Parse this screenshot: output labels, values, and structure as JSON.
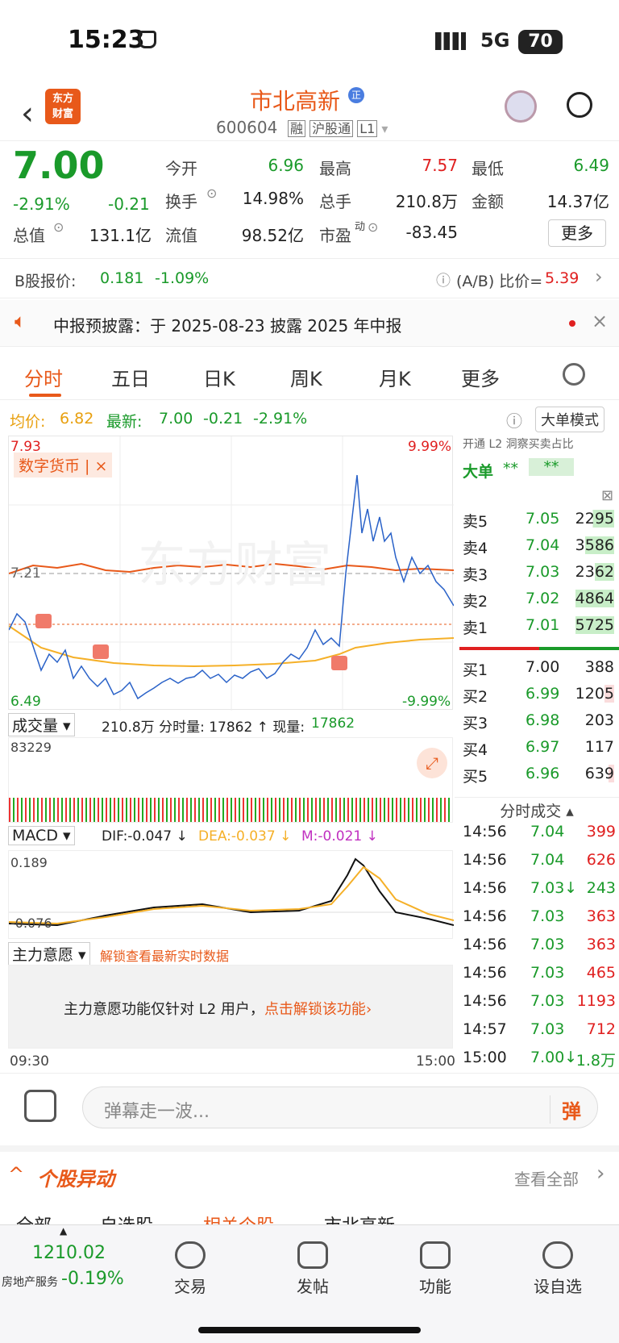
{
  "status": {
    "time": "15:23",
    "network": "5G",
    "battery": "70"
  },
  "header": {
    "stock_name": "市北高新",
    "badge": "正",
    "code": "600604",
    "tags": [
      "融",
      "沪股通",
      "L1"
    ]
  },
  "quote": {
    "price": "7.00",
    "pct": "-2.91%",
    "chg": "-0.21",
    "f1": [
      {
        "k": "今开",
        "v": "6.96"
      },
      {
        "k": "最高",
        "v": "7.57"
      },
      {
        "k": "最低",
        "v": "6.49"
      }
    ],
    "f2": [
      {
        "k": "换手",
        "v": "14.98%"
      },
      {
        "k": "总手",
        "v": "210.8万"
      },
      {
        "k": "金额",
        "v": "14.37亿"
      }
    ],
    "f3": [
      {
        "k": "总值",
        "v": "131.1亿"
      },
      {
        "k": "流值",
        "v": "98.52亿"
      },
      {
        "k": "市盈",
        "sup": "动",
        "v": "-83.45"
      }
    ],
    "more": "更多"
  },
  "bshare": {
    "label": "B股报价:",
    "price": "0.181",
    "pct": "-1.09%",
    "ratio_label": "(A/B) 比价=",
    "ratio": "5.39"
  },
  "notice": {
    "text": "中报预披露：于 2025-08-23 披露 2025 年中报"
  },
  "tabs": [
    "分时",
    "五日",
    "日K",
    "周K",
    "月K",
    "更多"
  ],
  "chart_info": {
    "avg_label": "均价:",
    "avg": "6.82",
    "last_label": "最新:",
    "last": "7.00",
    "chg": "-0.21",
    "pct": "-2.91%",
    "mode": "大单模式"
  },
  "chart_axis": {
    "top": "7.93",
    "top_pct": "9.99%",
    "mid": "7.21",
    "bottom": "6.49",
    "bottom_pct": "-9.99%",
    "start": "09:30",
    "end": "15:00"
  },
  "chart_tag": "数字货币",
  "watermark": "东方财富",
  "volume": {
    "label": "成交量",
    "summary": "210.8万 分时量: 17862 ↑ 现量:",
    "now": "17862",
    "max": "83229"
  },
  "macd": {
    "label": "MACD",
    "dif": "DIF:-0.047 ↓",
    "dea": "DEA:-0.037 ↓",
    "m": "M:-0.021 ↓",
    "top": "0.189",
    "bottom": "-0.076"
  },
  "main_force": {
    "label": "主力意愿",
    "unlock": "解锁查看最新实时数据",
    "msg": "主力意愿功能仅针对 L2 用户，",
    "link": "点击解锁该功能"
  },
  "order_book": {
    "l2": "开通 L2 洞察买卖占比",
    "big": "大单",
    "sells": [
      {
        "n": "卖5",
        "p": "7.05",
        "v": "2295"
      },
      {
        "n": "卖4",
        "p": "7.04",
        "v": "3586"
      },
      {
        "n": "卖3",
        "p": "7.03",
        "v": "2362"
      },
      {
        "n": "卖2",
        "p": "7.02",
        "v": "4864"
      },
      {
        "n": "卖1",
        "p": "7.01",
        "v": "5725"
      }
    ],
    "buys": [
      {
        "n": "买1",
        "p": "7.00",
        "v": "388"
      },
      {
        "n": "买2",
        "p": "6.99",
        "v": "1205"
      },
      {
        "n": "买3",
        "p": "6.98",
        "v": "203"
      },
      {
        "n": "买4",
        "p": "6.97",
        "v": "117"
      },
      {
        "n": "买5",
        "p": "6.96",
        "v": "639"
      }
    ]
  },
  "ticks": {
    "title": "分时成交",
    "rows": [
      {
        "t": "14:56",
        "p": "7.04",
        "v": "399"
      },
      {
        "t": "14:56",
        "p": "7.04",
        "v": "626"
      },
      {
        "t": "14:56",
        "p": "7.03↓",
        "v": "243"
      },
      {
        "t": "14:56",
        "p": "7.03",
        "v": "363"
      },
      {
        "t": "14:56",
        "p": "7.03",
        "v": "363"
      },
      {
        "t": "14:56",
        "p": "7.03",
        "v": "465"
      },
      {
        "t": "14:56",
        "p": "7.03",
        "v": "1193"
      },
      {
        "t": "14:57",
        "p": "7.03",
        "v": "712"
      },
      {
        "t": "15:00",
        "p": "7.00↓",
        "v": "1.8万"
      }
    ]
  },
  "danmu": {
    "placeholder": "弹幕走一波...",
    "btn": "弹"
  },
  "section": {
    "title": "个股异动",
    "link": "查看全部",
    "subtabs": [
      "全部",
      "自选股",
      "相关个股",
      "市北高新"
    ]
  },
  "bottom": {
    "index": "1210.02",
    "index_name": "房地产服务",
    "index_pct": "-0.19%",
    "items": [
      "交易",
      "发帖",
      "功能",
      "设自选"
    ]
  }
}
